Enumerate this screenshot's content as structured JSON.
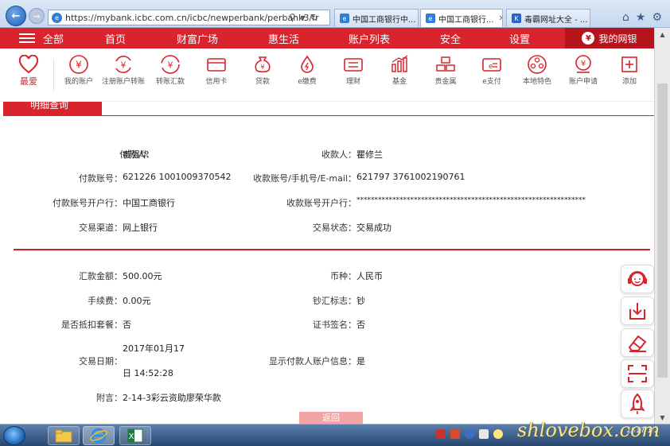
{
  "browser": {
    "url": "https://mybank.icbc.com.cn/icbc/newperbank/perbank3/fr",
    "tabs": [
      {
        "title": "中国工商银行中..."
      },
      {
        "title": "中国工商银行..."
      },
      {
        "title": "毒霸网址大全 - ..."
      }
    ]
  },
  "nav": {
    "menu": "全部",
    "items": [
      "首页",
      "财富广场",
      "惠生活",
      "账户列表",
      "安全",
      "设置"
    ],
    "mybank": "我的网银"
  },
  "quick": {
    "fav": "最爱",
    "items": [
      {
        "label": "我的账户"
      },
      {
        "label": "注册账户转账"
      },
      {
        "label": "转账汇款"
      },
      {
        "label": "信用卡"
      },
      {
        "label": "贷款"
      },
      {
        "label": "e缴费"
      },
      {
        "label": "理财"
      },
      {
        "label": "基金"
      },
      {
        "label": "贵金属"
      },
      {
        "label": "e支付"
      },
      {
        "label": "本地特色"
      },
      {
        "label": "账户申请"
      },
      {
        "label": "添加"
      }
    ]
  },
  "section": {
    "title": "明细查询"
  },
  "detail": {
    "payer_label": "付款人：",
    "payer": "臧强华",
    "payee_label": "收款人：",
    "payee": "瞿修兰",
    "payer_acct_label": "付款账号：",
    "payer_acct": "621226 1001009370542",
    "payee_acct_label": "收款账号/手机号/E-mail：",
    "payee_acct": "621797 3761002190761",
    "payer_bank_label": "付款账号开户行：",
    "payer_bank": "中国工商银行",
    "payee_bank_label": "收款账号开户行：",
    "payee_bank": "****************************************************************",
    "channel_label": "交易渠道：",
    "channel": "网上银行",
    "status_label": "交易状态：",
    "status": "交易成功",
    "amount_label": "汇款金额：",
    "amount": "500.00元",
    "currency_label": "币种：",
    "currency": "人民币",
    "fee_label": "手续费：",
    "fee": "0.00元",
    "cash_label": "钞汇标志：",
    "cash": "钞",
    "package_label": "是否抵扣套餐：",
    "package": "否",
    "cert_label": "证书签名：",
    "cert": "否",
    "date_label": "交易日期：",
    "date_line1": "2017年01月17",
    "date_line2": "日 14:52:28",
    "show_payer_label": "显示付款人账户信息：",
    "show_payer": "是",
    "note_label": "附言：",
    "note": "2-14-3彩云资助廖荣华款",
    "back": "返回"
  },
  "taskbar": {
    "clock": "2017/1/2"
  },
  "watermark": "shlovebox.com",
  "colors": {
    "brand_red": "#d9232d",
    "dark_red": "#b5141d"
  }
}
